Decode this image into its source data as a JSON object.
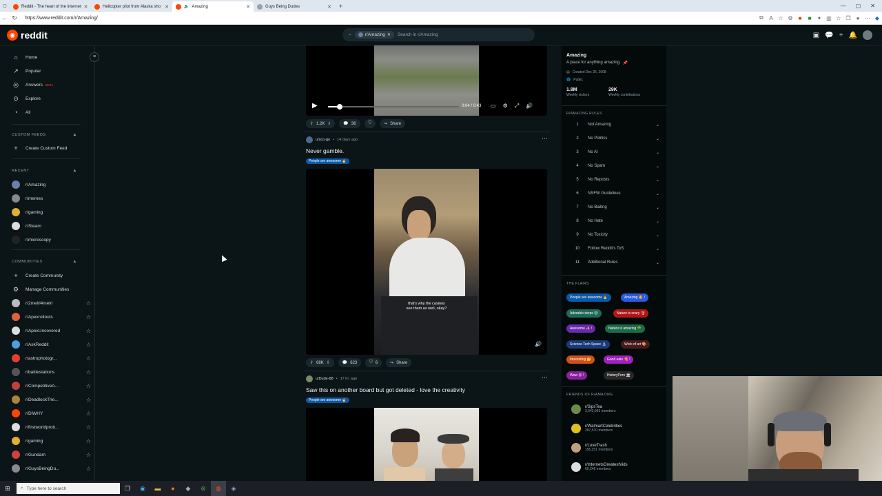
{
  "browser": {
    "tabs": [
      {
        "title": "Reddit - The heart of the internet",
        "active": false
      },
      {
        "title": "Helicopter pilot from Alaska sho",
        "active": false
      },
      {
        "title": "Amazing",
        "active": true
      },
      {
        "title": "Guys Being Dudes",
        "active": false
      }
    ],
    "url": "https://www.reddit.com/r/Amazing/"
  },
  "header": {
    "logo_text": "reddit",
    "search_chip": "r/Amazing",
    "search_placeholder": "Search in r/Amazing"
  },
  "sidebar": {
    "nav": [
      {
        "label": "Home",
        "icon": "home-icon"
      },
      {
        "label": "Popular",
        "icon": "popular-icon"
      },
      {
        "label": "Answers",
        "icon": "answers-icon",
        "badge": "BETA"
      },
      {
        "label": "Explore",
        "icon": "explore-icon"
      },
      {
        "label": "All",
        "icon": "all-icon"
      }
    ],
    "custom_feeds_heading": "CUSTOM FEEDS",
    "create_custom_feed": "Create Custom Feed",
    "recent_heading": "RECENT",
    "recent": [
      {
        "label": "r/Amazing",
        "color": "#6c7fa8"
      },
      {
        "label": "r/memes",
        "color": "#888888"
      },
      {
        "label": "r/gaming",
        "color": "#e0b030"
      },
      {
        "label": "r/Steam",
        "color": "#dddddd"
      },
      {
        "label": "r/microscopy",
        "color": "#222222"
      }
    ],
    "communities_heading": "COMMUNITIES",
    "create_community": "Create Community",
    "manage_communities": "Manage Communities",
    "communities": [
      {
        "label": "r/2meirl4meirl",
        "color": "#bbbbbb"
      },
      {
        "label": "r/Apexrollouts",
        "color": "#e0603a"
      },
      {
        "label": "r/ApexUncovered",
        "color": "#dddddd"
      },
      {
        "label": "r/AskReddit",
        "color": "#4aa0e0"
      },
      {
        "label": "r/astrophotogr...",
        "color": "#e04030"
      },
      {
        "label": "r/battlestations",
        "color": "#555555"
      },
      {
        "label": "r/CompetitiveA...",
        "color": "#c04040"
      },
      {
        "label": "r/DeadlockThe...",
        "color": "#b08040"
      },
      {
        "label": "r/DiWHY",
        "color": "#ff4500"
      },
      {
        "label": "r/firstworldprob...",
        "color": "#dddddd"
      },
      {
        "label": "r/gaming",
        "color": "#e0b030"
      },
      {
        "label": "r/Gundam",
        "color": "#d04040"
      },
      {
        "label": "r/GuysBeingDu...",
        "color": "#8a8a8a"
      }
    ]
  },
  "feed": {
    "post1": {
      "time": "0:04 / 0:43",
      "upvotes": "1.2K",
      "comments": "36",
      "share": "Share"
    },
    "post2": {
      "user": "u/sco-go",
      "age": "14 days ago",
      "title": "Never gamble.",
      "flair": "People are awesome 🔥",
      "subtitle_line1": "that's why the casinos",
      "subtitle_line2": "see them as well, okay?",
      "upvotes": "68K",
      "comments": "623",
      "awards": "6",
      "share": "Share"
    },
    "post3": {
      "user": "u/Dude-88",
      "age": "17 hr. ago",
      "title": "Saw this on another board but got deleted - love the creativity",
      "flair": "People are awesome 🔥"
    }
  },
  "right_sidebar": {
    "name": "Amazing",
    "description": "A place for anything amazing.",
    "created": "Created Dec 26, 2008",
    "visibility": "Public",
    "weekly_visitors_value": "1.8M",
    "weekly_visitors_label": "Weekly visitors",
    "weekly_contrib_value": "29K",
    "weekly_contrib_label": "Weekly contributions",
    "rules_heading": "R/AMAZING RULES",
    "rules": [
      {
        "n": "1",
        "t": "Not Amazing"
      },
      {
        "n": "2",
        "t": "No Politics"
      },
      {
        "n": "3",
        "t": "No AI"
      },
      {
        "n": "4",
        "t": "No Spam"
      },
      {
        "n": "5",
        "t": "No Reposts"
      },
      {
        "n": "6",
        "t": "NSFW Guidelines"
      },
      {
        "n": "7",
        "t": "No Baiting"
      },
      {
        "n": "8",
        "t": "No Hate"
      },
      {
        "n": "9",
        "t": "No Toxicity"
      },
      {
        "n": "10",
        "t": "Follow Reddit's ToS"
      },
      {
        "n": "11",
        "t": "Additional Rules"
      }
    ],
    "flairs_heading": "THE FLAIRS",
    "flairs": [
      {
        "label": "People are awesome 🔥",
        "color": "#0a5aa7"
      },
      {
        "label": "Amazing 🤩 !",
        "color": "#2a5adf"
      },
      {
        "label": "Adorable derps 🐱",
        "color": "#1e6b5a"
      },
      {
        "label": "Nature is scary 🌪",
        "color": "#b01818"
      },
      {
        "label": "Awesome ✨ !",
        "color": "#6a2ab0"
      },
      {
        "label": "Nature is amazing 🌳",
        "color": "#1e6b4a"
      },
      {
        "label": "Science Tech Space 🔬",
        "color": "#1a3b7a"
      },
      {
        "label": "Work of art 🎨",
        "color": "#4a1a1a"
      },
      {
        "label": "Interesting 🤔",
        "color": "#d0501a"
      },
      {
        "label": "Good eats 🍕 !",
        "color": "#a020c0"
      },
      {
        "label": "Wow 😮 !",
        "color": "#8a20a0"
      },
      {
        "label": "HistoryPorn 🏛",
        "color": "#2a2a2a"
      }
    ],
    "friends_heading": "FRIENDS OF R/AMAZING",
    "friends": [
      {
        "name": "r/SipsTea",
        "members": "3,042,993 members",
        "color": "#6a8a4a"
      },
      {
        "name": "r/WalmartCelebrities",
        "members": "287,570 members",
        "color": "#e0c020"
      },
      {
        "name": "r/LoveTrash",
        "members": "156,251 members",
        "color": "#c0a080"
      },
      {
        "name": "r/InternetsGreatestVids",
        "members": "60,248 members",
        "color": "#dddddd"
      }
    ]
  },
  "taskbar": {
    "search_placeholder": "Type here to search"
  }
}
